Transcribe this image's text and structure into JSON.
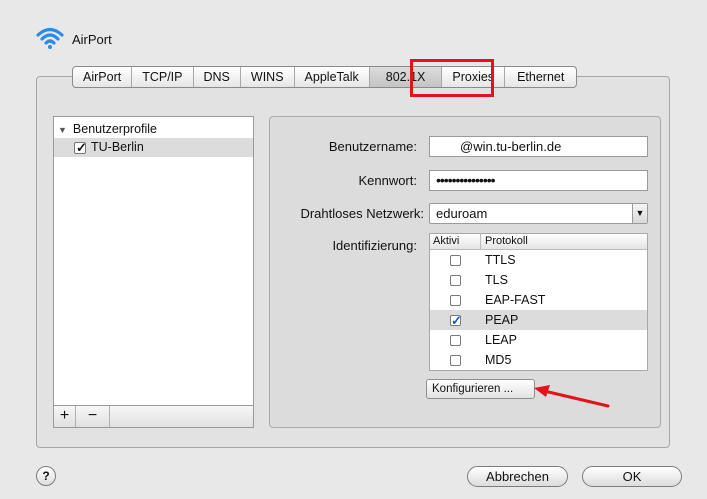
{
  "window": {
    "title": "AirPort"
  },
  "tabs": [
    {
      "label": "AirPort"
    },
    {
      "label": "TCP/IP"
    },
    {
      "label": "DNS"
    },
    {
      "label": "WINS"
    },
    {
      "label": "AppleTalk"
    },
    {
      "label": "802.1X",
      "active": true
    },
    {
      "label": "Proxies"
    },
    {
      "label": "Ethernet"
    }
  ],
  "profiles": {
    "header": "Benutzerprofile",
    "items": [
      {
        "label": "TU-Berlin",
        "checked": true
      }
    ],
    "add_label": "+",
    "remove_label": "−"
  },
  "form": {
    "username_label": "Benutzername:",
    "username_value": "@win.tu-berlin.de",
    "password_label": "Kennwort:",
    "password_value": "•••••••••••••••",
    "network_label": "Drahtloses Netzwerk:",
    "network_value": "eduroam",
    "ident_label": "Identifizierung:"
  },
  "protocols": {
    "col_active": "Aktivi",
    "col_protocol": "Protokoll",
    "rows": [
      {
        "name": "TTLS",
        "checked": false
      },
      {
        "name": "TLS",
        "checked": false
      },
      {
        "name": "EAP-FAST",
        "checked": false
      },
      {
        "name": "PEAP",
        "checked": true
      },
      {
        "name": "LEAP",
        "checked": false
      },
      {
        "name": "MD5",
        "checked": false
      }
    ]
  },
  "configure_label": "Konfigurieren ...",
  "buttons": {
    "help": "?",
    "cancel": "Abbrechen",
    "ok": "OK"
  },
  "colors": {
    "highlight": "#e0141a",
    "wifi_icon": "#2a8be8",
    "check": "#1a56c8"
  }
}
